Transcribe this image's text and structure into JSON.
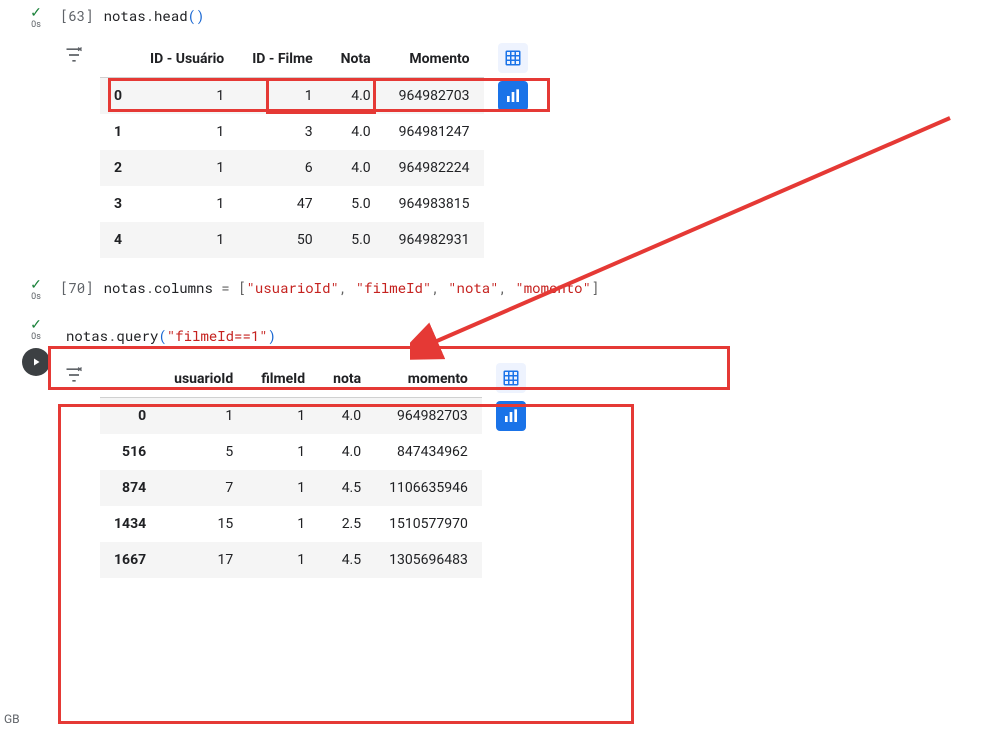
{
  "cells": {
    "c1": {
      "exec_count": "[63]",
      "timing": "0s",
      "code_tokens": [
        "notas",
        ".",
        "head",
        "(",
        ")"
      ],
      "output_table": {
        "headers": [
          "",
          "ID - Usuário",
          "ID - Filme",
          "Nota",
          "Momento"
        ],
        "rows": [
          {
            "idx": "0",
            "c": [
              "1",
              "1",
              "4.0",
              "964982703"
            ]
          },
          {
            "idx": "1",
            "c": [
              "1",
              "3",
              "4.0",
              "964981247"
            ]
          },
          {
            "idx": "2",
            "c": [
              "1",
              "6",
              "4.0",
              "964982224"
            ]
          },
          {
            "idx": "3",
            "c": [
              "1",
              "47",
              "5.0",
              "964983815"
            ]
          },
          {
            "idx": "4",
            "c": [
              "1",
              "50",
              "5.0",
              "964982931"
            ]
          }
        ]
      }
    },
    "c2": {
      "exec_count": "[70]",
      "timing": "0s",
      "code_plain": "notas.columns = [\"usuarioId\", \"filmeId\", \"nota\", \"momento\"]"
    },
    "c3": {
      "timing": "0s",
      "code_plain": "notas.query(\"filmeId==1\")",
      "output_table": {
        "headers": [
          "",
          "usuarioId",
          "filmeId",
          "nota",
          "momento"
        ],
        "rows": [
          {
            "idx": "0",
            "c": [
              "1",
              "1",
              "4.0",
              "964982703"
            ]
          },
          {
            "idx": "516",
            "c": [
              "5",
              "1",
              "4.0",
              "847434962"
            ]
          },
          {
            "idx": "874",
            "c": [
              "7",
              "1",
              "4.5",
              "1106635946"
            ]
          },
          {
            "idx": "1434",
            "c": [
              "15",
              "1",
              "2.5",
              "1510577970"
            ]
          },
          {
            "idx": "1667",
            "c": [
              "17",
              "1",
              "4.5",
              "1305696483"
            ]
          }
        ]
      }
    }
  },
  "corner_text": "GB",
  "icons": {
    "filter": "variable-filter-icon",
    "grid": "interactive-table-icon",
    "chart": "quick-chart-icon",
    "play": "run-cell-icon",
    "check": "executed-check-icon"
  }
}
